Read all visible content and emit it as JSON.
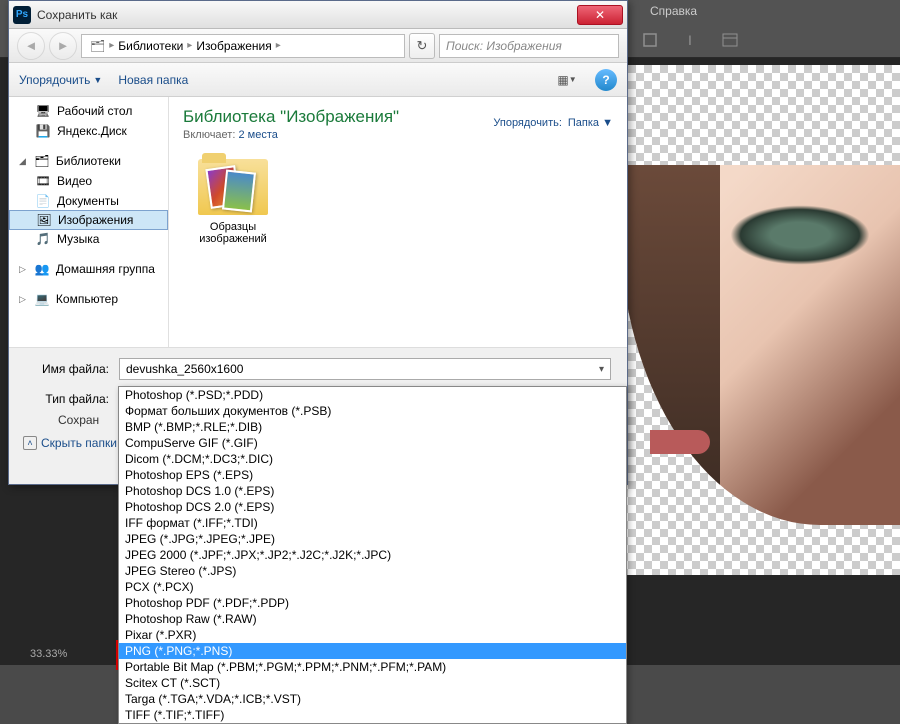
{
  "ps": {
    "help_menu": "Справка",
    "zoom": "33.33%"
  },
  "dialog": {
    "title": "Сохранить как",
    "breadcrumb": [
      "Библиотеки",
      "Изображения"
    ],
    "search_placeholder": "Поиск: Изображения",
    "organize": "Упорядочить",
    "new_folder": "Новая папка"
  },
  "sidebar": {
    "desktop": "Рабочий стол",
    "yadisk": "Яндекс.Диск",
    "libraries": "Библиотеки",
    "video": "Видео",
    "documents": "Документы",
    "images": "Изображения",
    "music": "Музыка",
    "homegroup": "Домашняя группа",
    "computer": "Компьютер"
  },
  "content": {
    "title": "Библиотека \"Изображения\"",
    "includes_label": "Включает:",
    "includes_link": "2 места",
    "sort_label": "Упорядочить:",
    "sort_value": "Папка",
    "folder_name": "Образцы изображений"
  },
  "fields": {
    "filename_label": "Имя файла:",
    "filename_value": "devushka_2560x1600",
    "filetype_label": "Тип файла:",
    "filetype_value": "Photoshop (*.PSD;*.PDD)",
    "save_label": "Сохран"
  },
  "dropdown": {
    "items": [
      "Photoshop (*.PSD;*.PDD)",
      "Формат больших документов (*.PSB)",
      "BMP (*.BMP;*.RLE;*.DIB)",
      "CompuServe GIF (*.GIF)",
      "Dicom (*.DCM;*.DC3;*.DIC)",
      "Photoshop EPS (*.EPS)",
      "Photoshop DCS 1.0 (*.EPS)",
      "Photoshop DCS 2.0 (*.EPS)",
      "IFF формат (*.IFF;*.TDI)",
      "JPEG (*.JPG;*.JPEG;*.JPE)",
      "JPEG 2000 (*.JPF;*.JPX;*.JP2;*.J2C;*.J2K;*.JPC)",
      "JPEG Stereo (*.JPS)",
      "PCX (*.PCX)",
      "Photoshop PDF (*.PDF;*.PDP)",
      "Photoshop Raw (*.RAW)",
      "Pixar (*.PXR)",
      "PNG (*.PNG;*.PNS)",
      "Portable Bit Map (*.PBM;*.PGM;*.PPM;*.PNM;*.PFM;*.PAM)",
      "Scitex CT (*.SCT)",
      "Targa (*.TGA;*.VDA;*.ICB;*.VST)",
      "TIFF (*.TIF;*.TIFF)"
    ],
    "selected_index": 16
  },
  "footer": {
    "hide_folders": "Скрыть папки"
  }
}
